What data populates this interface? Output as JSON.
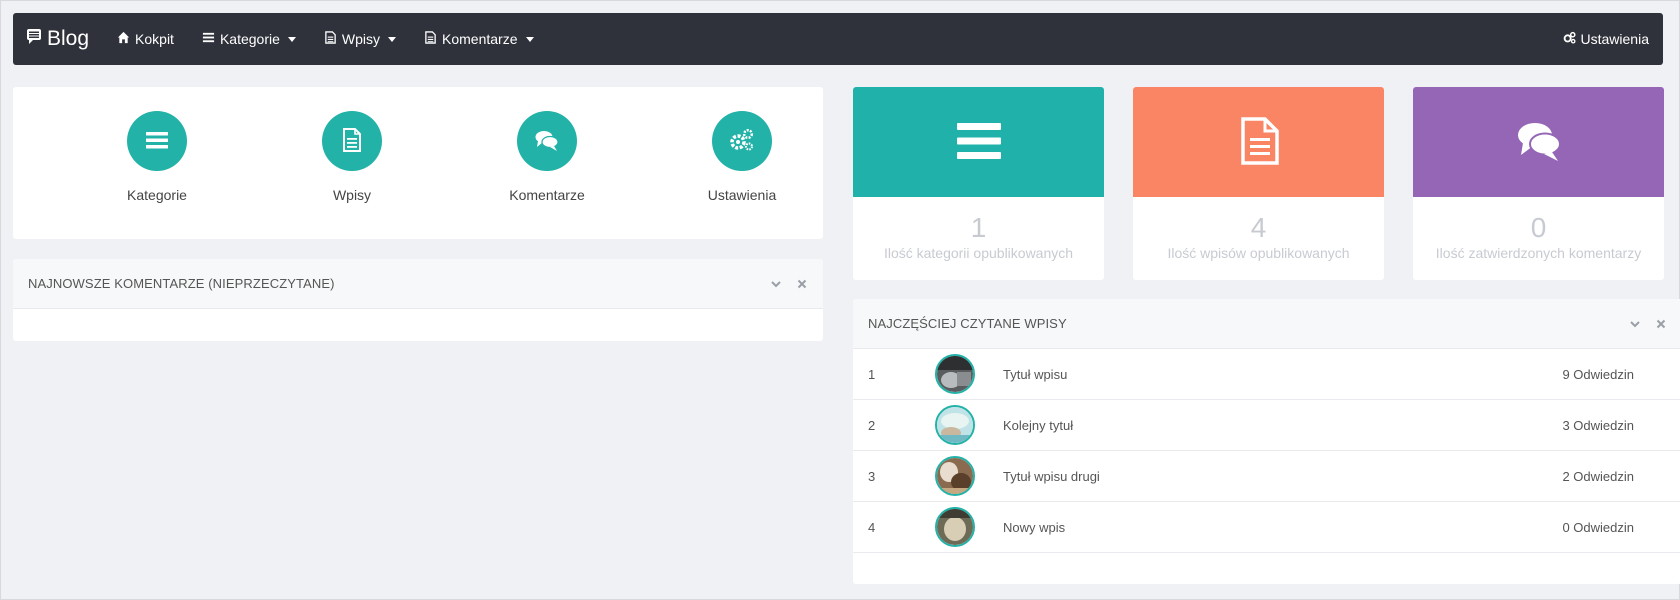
{
  "navbar": {
    "brand": "Blog",
    "items": [
      {
        "label": "Kokpit",
        "icon": "home-icon"
      },
      {
        "label": "Kategorie",
        "icon": "list-icon"
      },
      {
        "label": "Wpisy",
        "icon": "file-icon"
      },
      {
        "label": "Komentarze",
        "icon": "file-icon"
      }
    ],
    "settings": "Ustawienia"
  },
  "shortcuts": [
    {
      "label": "Kategorie",
      "icon": "list-icon"
    },
    {
      "label": "Wpisy",
      "icon": "file-icon"
    },
    {
      "label": "Komentarze",
      "icon": "comments-icon"
    },
    {
      "label": "Ustawienia",
      "icon": "cogs-icon"
    }
  ],
  "comments_panel": {
    "title": "NAJNOWSZE KOMENTARZE (NIEPRZECZYTANE)"
  },
  "stats": [
    {
      "value": "1",
      "label": "Ilość kategorii opublikowanych",
      "color": "#20b2aa",
      "icon": "list-icon"
    },
    {
      "value": "4",
      "label": "Ilość wpisów opublikowanych",
      "color": "#fa8564",
      "icon": "file-icon"
    },
    {
      "value": "0",
      "label": "Ilość zatwierdzonych komentarzy",
      "color": "#9466b5",
      "icon": "comments-icon"
    }
  ],
  "popular_panel": {
    "title": "NAJCZĘŚCIEJ CZYTANE WPISY",
    "rows": [
      {
        "index": "1",
        "title": "Tytuł wpisu",
        "visits": "9 Odwiedzin"
      },
      {
        "index": "2",
        "title": "Kolejny tytuł",
        "visits": "3 Odwiedzin"
      },
      {
        "index": "3",
        "title": "Tytuł wpisu drugi",
        "visits": "2 Odwiedzin"
      },
      {
        "index": "4",
        "title": "Nowy wpis",
        "visits": "0 Odwiedzin"
      }
    ]
  },
  "colors": {
    "accent": "#22b2a8",
    "navbar": "#2f323b",
    "background": "#f0f1f5"
  }
}
